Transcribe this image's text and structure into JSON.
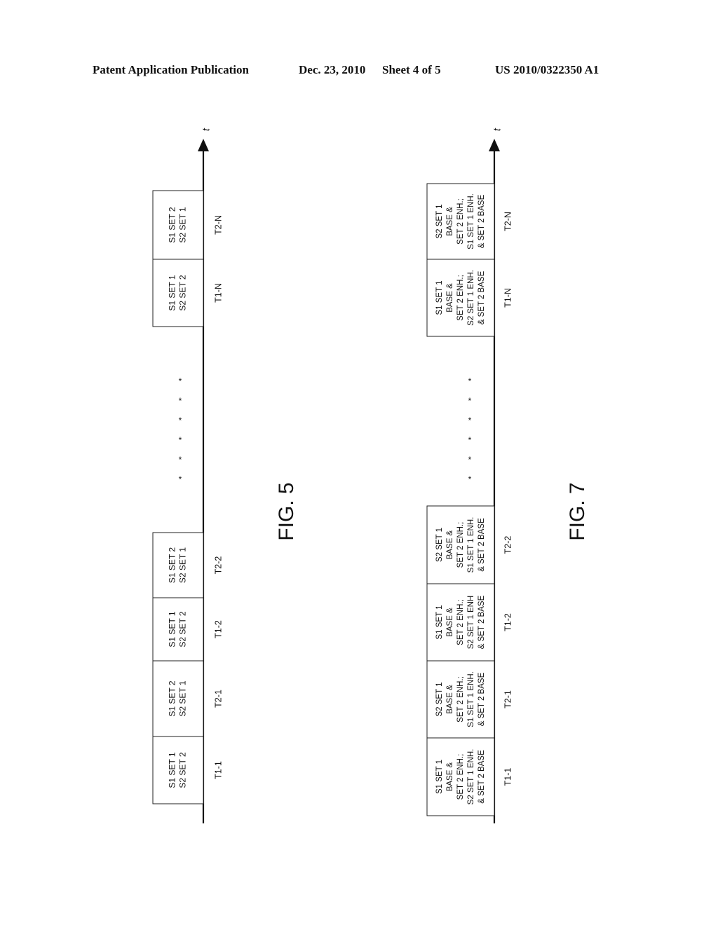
{
  "header": {
    "left": "Patent Application Publication",
    "center_date": "Dec. 23, 2010",
    "center_sheet": "Sheet 4 of 5",
    "right": "US 2010/0322350 A1"
  },
  "figures": [
    {
      "id": "fig5",
      "caption": "FIG. 5",
      "axis_label": "t",
      "ellipsis": "* * * * * *",
      "slots": [
        {
          "time": "T1-1",
          "lines": [
            "S1 SET 1",
            "S2 SET 2"
          ]
        },
        {
          "time": "T2-1",
          "lines": [
            "S1 SET 2",
            "S2 SET 1"
          ]
        },
        {
          "time": "T1-2",
          "lines": [
            "S1 SET 1",
            "S2 SET 2"
          ]
        },
        {
          "time": "T2-2",
          "lines": [
            "S1 SET 2",
            "S2 SET 1"
          ]
        },
        {
          "time": "T1-N",
          "lines": [
            "S1 SET 1",
            "S2 SET 2"
          ]
        },
        {
          "time": "T2-N",
          "lines": [
            "S1 SET 2",
            "S2 SET 1"
          ]
        }
      ]
    },
    {
      "id": "fig7",
      "caption": "FIG. 7",
      "axis_label": "t",
      "ellipsis": "* * * * * *",
      "slots": [
        {
          "time": "T1-1",
          "lines": [
            "S1 SET 1",
            "BASE &",
            "SET 2 ENH.;",
            "S2 SET 1 ENH.",
            "& SET 2 BASE"
          ]
        },
        {
          "time": "T2-1",
          "lines": [
            "S2 SET 1",
            "BASE &",
            "SET 2 ENH.;",
            "S1 SET 1 ENH.",
            "& SET 2 BASE"
          ]
        },
        {
          "time": "T1-2",
          "lines": [
            "S1 SET 1",
            "BASE &",
            "SET 2 ENH.;",
            "S2 SET 1 ENH",
            "& SET 2 BASE"
          ]
        },
        {
          "time": "T2-2",
          "lines": [
            "S2 SET 1",
            "BASE &",
            "SET 2 ENH.;",
            "S1 SET 1 ENH.",
            "& SET 2 BASE"
          ]
        },
        {
          "time": "T1-N",
          "lines": [
            "S1 SET 1",
            "BASE &",
            "SET 2 ENH.;",
            "S2 SET 1 ENH.",
            "& SET 2 BASE"
          ]
        },
        {
          "time": "T2-N",
          "lines": [
            "S2 SET 1",
            "BASE &",
            "SET 2 ENH.;",
            "S1 SET 1 ENH.",
            "& SET 2 BASE"
          ]
        }
      ]
    }
  ]
}
